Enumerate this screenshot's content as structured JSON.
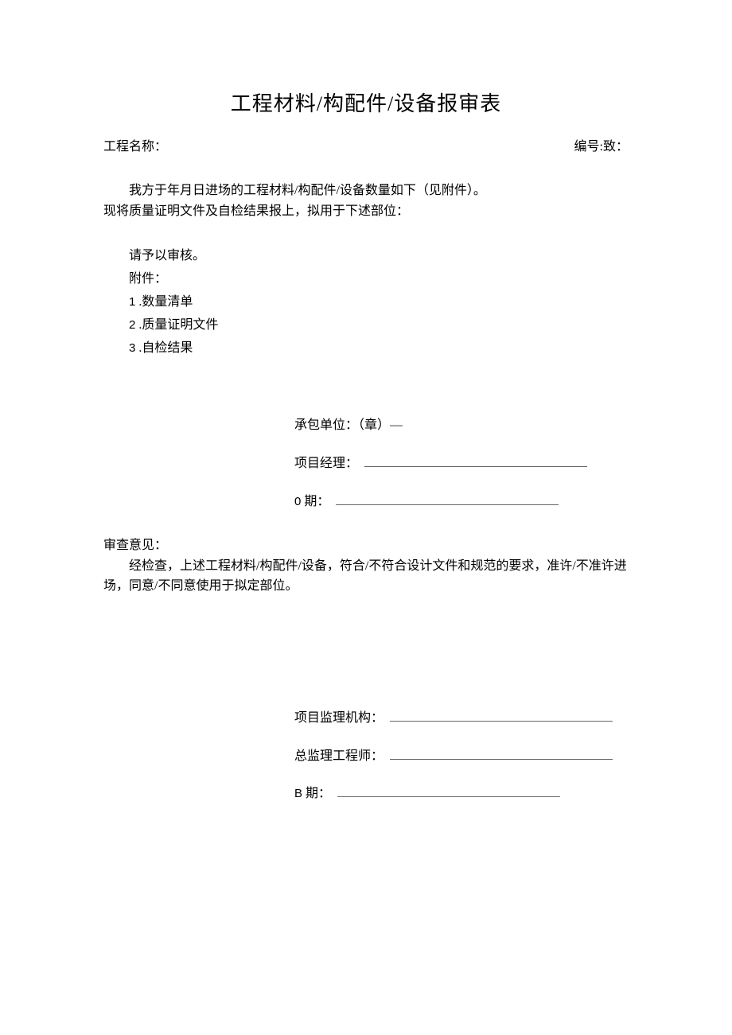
{
  "title": "工程材料/构配件/设备报审表",
  "header": {
    "project_label": "工程名称：",
    "serial_label": "编号:致："
  },
  "body": {
    "line1": "我方于年月日进场的工程材料/构配件/设备数量如下（见附件）。",
    "line2": "现将质量证明文件及自检结果报上，拟用于下述部位：",
    "review_req": "请予以审核。",
    "attach_label": "附件："
  },
  "attachments": [
    {
      "num": "1",
      "text": " .数量清单"
    },
    {
      "num": "2",
      "text": " .质量证明文件"
    },
    {
      "num": "3",
      "text": " .自检结果"
    }
  ],
  "sig1": {
    "contractor": "承包单位：（章）—",
    "pm_label": "项目经理：",
    "date_prefix": "0",
    "date_label": " 期："
  },
  "opinion": {
    "heading": "审查意见：",
    "text": "经检查，上述工程材料/构配件/设备，符合/不符合设计文件和规范的要求，准许/不准许进场，同意/不同意使用于拟定部位。"
  },
  "sig2": {
    "org_label": "项目监理机构：",
    "eng_label": "总监理工程师：",
    "date_prefix": "B",
    "date_label": " 期："
  }
}
